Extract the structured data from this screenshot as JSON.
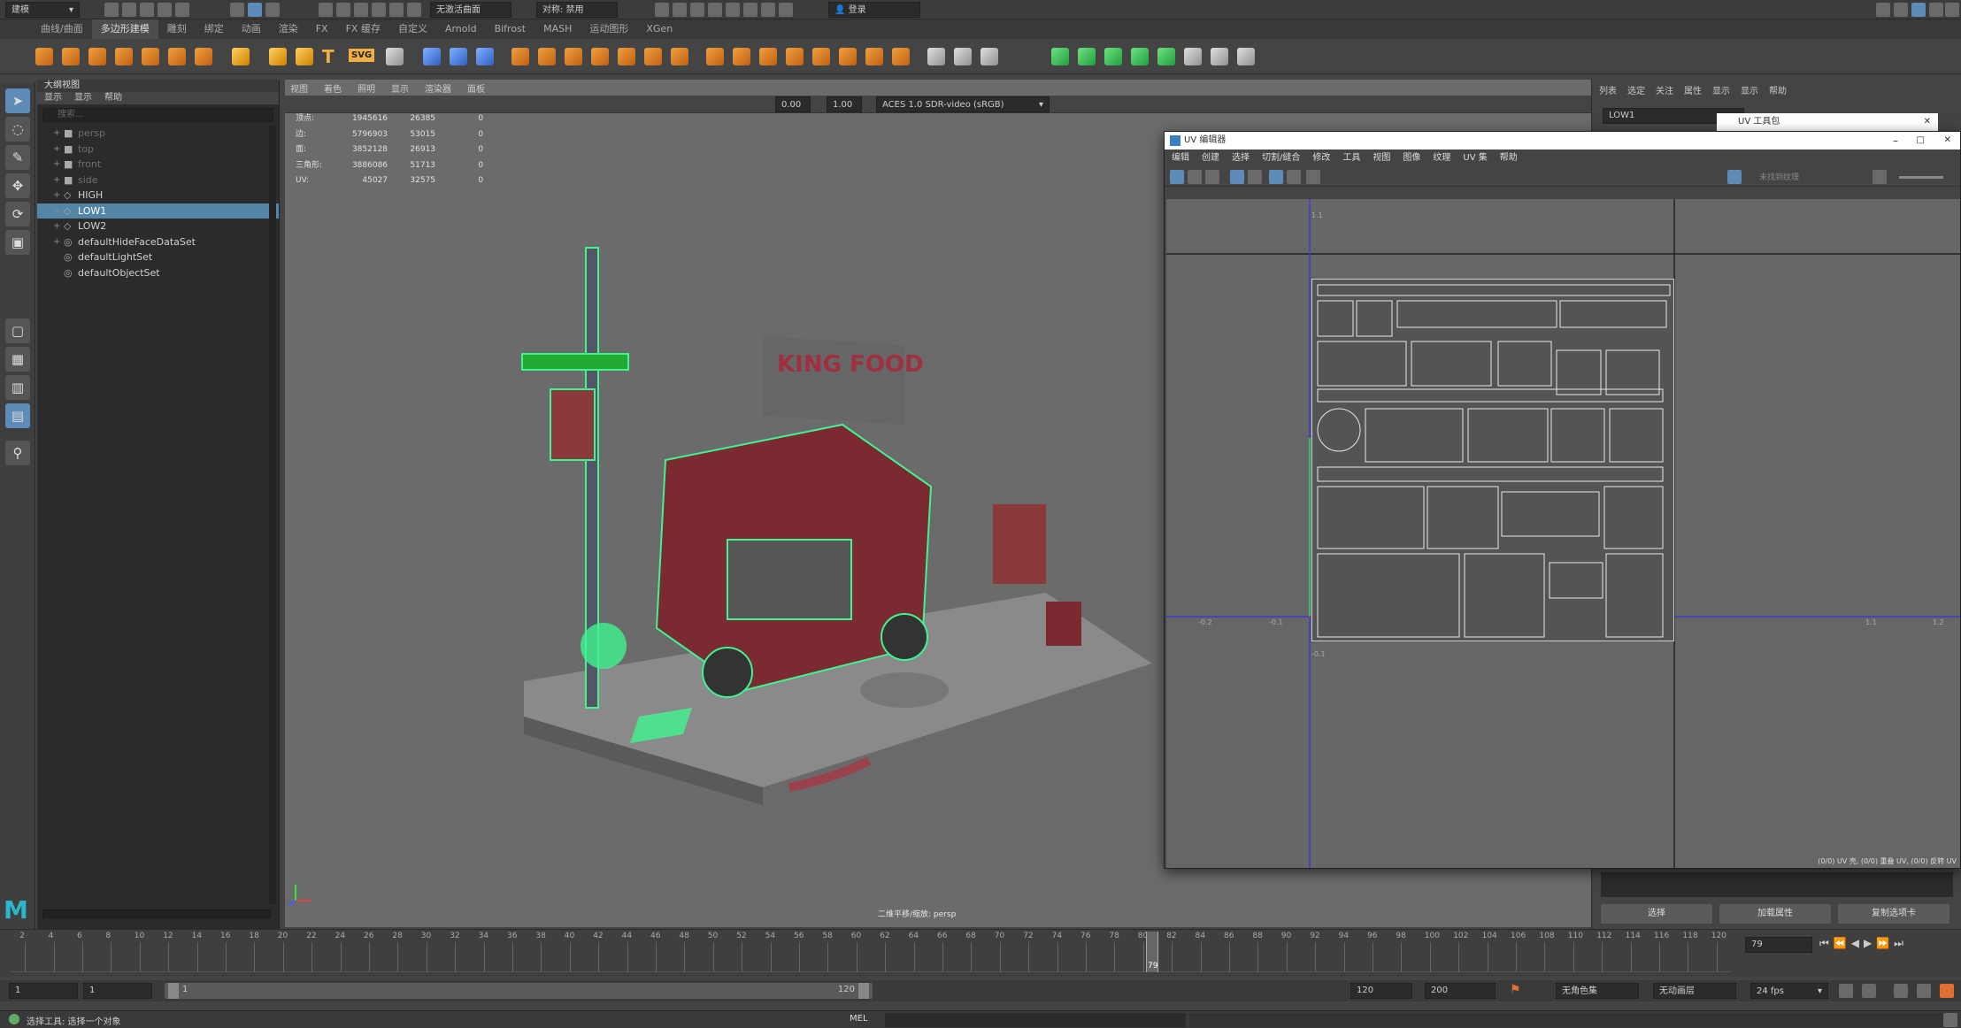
{
  "statusline": {
    "workspace": "建模",
    "live_surface": "无激活曲面",
    "symmetry": "对称: 禁用",
    "login": "登录"
  },
  "shelf": {
    "tabs": [
      "曲线/曲面",
      "多边形建模",
      "雕刻",
      "绑定",
      "动画",
      "渲染",
      "FX",
      "FX 缓存",
      "自定义",
      "Arnold",
      "Bifrost",
      "MASH",
      "运动图形",
      "XGen"
    ],
    "active_tab": "多边形建模",
    "text_icon": "T",
    "svg_icon": "SVG"
  },
  "outliner": {
    "title": "大纲视图",
    "menu": [
      "显示",
      "显示",
      "帮助"
    ],
    "search_placeholder": "搜索...",
    "items": [
      {
        "label": "persp",
        "icon": "camera-icon",
        "dim": true,
        "expand": "+"
      },
      {
        "label": "top",
        "icon": "camera-icon",
        "dim": true,
        "expand": "+"
      },
      {
        "label": "front",
        "icon": "camera-icon",
        "dim": true,
        "expand": "+"
      },
      {
        "label": "side",
        "icon": "camera-icon",
        "dim": true,
        "expand": "+"
      },
      {
        "label": "HIGH",
        "icon": "group-icon",
        "dim": false,
        "expand": "+"
      },
      {
        "label": "LOW1",
        "icon": "group-icon",
        "dim": false,
        "expand": "+",
        "selected": true
      },
      {
        "label": "LOW2",
        "icon": "group-icon",
        "dim": false,
        "expand": "+"
      },
      {
        "label": "defaultHideFaceDataSet",
        "icon": "set-icon",
        "dim": false,
        "expand": "+"
      },
      {
        "label": "defaultLightSet",
        "icon": "set-icon",
        "dim": false,
        "expand": ""
      },
      {
        "label": "defaultObjectSet",
        "icon": "set-icon",
        "dim": false,
        "expand": ""
      }
    ]
  },
  "viewport": {
    "menu": [
      "视图",
      "着色",
      "照明",
      "显示",
      "渲染器",
      "面板"
    ],
    "toolbar": {
      "exposure": "0.00",
      "gamma": "1.00",
      "color_transform": "ACES 1.0 SDR-video (sRGB)"
    },
    "hud": [
      {
        "label": "顶点:",
        "a": "1945616",
        "b": "26385",
        "c": "0"
      },
      {
        "label": "边:",
        "a": "5796903",
        "b": "53015",
        "c": "0"
      },
      {
        "label": "面:",
        "a": "3852128",
        "b": "26913",
        "c": "0"
      },
      {
        "label": "三角形:",
        "a": "3886086",
        "b": "51713",
        "c": "0"
      },
      {
        "label": "UV:",
        "a": "45027",
        "b": "32575",
        "c": "0"
      }
    ],
    "camera_label": "二维平移/缩放: persp",
    "sign_text": "KING FOOD"
  },
  "attribute_editor": {
    "menu": [
      "列表",
      "选定",
      "关注",
      "属性",
      "显示",
      "显示",
      "帮助"
    ],
    "node_name": "LOW1",
    "buttons": [
      "选择",
      "加载属性",
      "复制选项卡"
    ]
  },
  "uv_toolkit": {
    "title": "UV 工具包"
  },
  "uv_editor": {
    "title": "UV 编辑器",
    "menu": [
      "编辑",
      "创建",
      "选择",
      "切割/缝合",
      "修改",
      "工具",
      "视图",
      "图像",
      "纹理",
      "UV 集",
      "帮助"
    ],
    "texture_dropdown": "未找到纹理",
    "status": "(0/0) UV 壳, (0/0) 重叠 UV, (0/0) 反转 UV",
    "axis_labels": [
      "-0.2",
      "-0.1",
      "1.1",
      "1.2",
      "1.1",
      "-0.1"
    ]
  },
  "timeline": {
    "ticks": [
      "2",
      "4",
      "6",
      "8",
      "10",
      "12",
      "14",
      "16",
      "18",
      "20",
      "22",
      "24",
      "26",
      "28",
      "30",
      "32",
      "34",
      "36",
      "38",
      "40",
      "42",
      "44",
      "46",
      "48",
      "50",
      "52",
      "54",
      "56",
      "58",
      "60",
      "62",
      "64",
      "66",
      "68",
      "70",
      "72",
      "74",
      "76",
      "78",
      "80",
      "82",
      "84",
      "86",
      "88",
      "90",
      "92",
      "94",
      "96",
      "98",
      "100",
      "102",
      "104",
      "106",
      "108",
      "110",
      "112",
      "114",
      "116",
      "118",
      "120"
    ],
    "current_frame": "79",
    "playhead_fraction": 0.66,
    "frame_field": "79"
  },
  "range": {
    "start": "1",
    "anim_start": "1",
    "range_start_label": "1",
    "range_end_label": "120",
    "end": "120",
    "anim_end": "200",
    "character_set": "无角色集",
    "anim_layer": "无动画层",
    "fps": "24 fps"
  },
  "cmdline": {
    "lang": "MEL",
    "help": "选择工具: 选择一个对象"
  }
}
